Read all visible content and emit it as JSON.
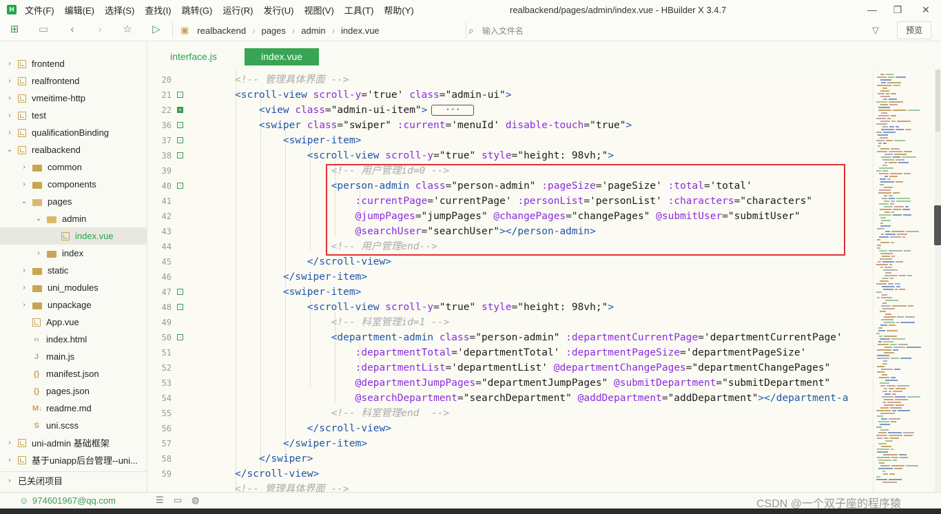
{
  "titlebar": {
    "menus": [
      "文件(F)",
      "编辑(E)",
      "选择(S)",
      "查找(I)",
      "跳转(G)",
      "运行(R)",
      "发行(U)",
      "视图(V)",
      "工具(T)",
      "帮助(Y)"
    ],
    "window_title": "realbackend/pages/admin/index.vue - HBuilder X 3.4.7"
  },
  "toolbar": {
    "breadcrumb": [
      "realbackend",
      "pages",
      "admin",
      "index.vue"
    ],
    "search_placeholder": "输入文件名",
    "preview_label": "预览"
  },
  "sidebar": {
    "items": [
      {
        "label": "frontend",
        "depth": 0,
        "kind": "project",
        "open": false
      },
      {
        "label": "realfrontend",
        "depth": 0,
        "kind": "project",
        "open": false
      },
      {
        "label": "vmeitime-http",
        "depth": 0,
        "kind": "project",
        "open": false
      },
      {
        "label": "test",
        "depth": 0,
        "kind": "project",
        "open": false
      },
      {
        "label": "qualificationBinding",
        "depth": 0,
        "kind": "project",
        "open": false
      },
      {
        "label": "realbackend",
        "depth": 0,
        "kind": "project",
        "open": true
      },
      {
        "label": "common",
        "depth": 1,
        "kind": "folder",
        "open": false
      },
      {
        "label": "components",
        "depth": 1,
        "kind": "folder",
        "open": false
      },
      {
        "label": "pages",
        "depth": 1,
        "kind": "folder",
        "open": true
      },
      {
        "label": "admin",
        "depth": 2,
        "kind": "folder",
        "open": true
      },
      {
        "label": "index.vue",
        "depth": 3,
        "kind": "vue",
        "selected": true
      },
      {
        "label": "index",
        "depth": 2,
        "kind": "folder",
        "open": false
      },
      {
        "label": "static",
        "depth": 1,
        "kind": "folder",
        "open": false
      },
      {
        "label": "uni_modules",
        "depth": 1,
        "kind": "folder",
        "open": false
      },
      {
        "label": "unpackage",
        "depth": 1,
        "kind": "folder",
        "open": false
      },
      {
        "label": "App.vue",
        "depth": 1,
        "kind": "vue"
      },
      {
        "label": "index.html",
        "depth": 1,
        "kind": "html"
      },
      {
        "label": "main.js",
        "depth": 1,
        "kind": "js"
      },
      {
        "label": "manifest.json",
        "depth": 1,
        "kind": "json"
      },
      {
        "label": "pages.json",
        "depth": 1,
        "kind": "json"
      },
      {
        "label": "readme.md",
        "depth": 1,
        "kind": "md"
      },
      {
        "label": "uni.scss",
        "depth": 1,
        "kind": "scss"
      },
      {
        "label": "uni-admin 基础框架",
        "depth": 0,
        "kind": "project",
        "open": false
      },
      {
        "label": "基于uniapp后台管理--uni...",
        "depth": 0,
        "kind": "project",
        "open": false
      }
    ],
    "closed_projects_label": "已关闭项目"
  },
  "tabs": [
    {
      "label": "interface.js",
      "active": false
    },
    {
      "label": "index.vue",
      "active": true
    }
  ],
  "editor": {
    "line_numbers": [
      "20",
      "21",
      "22",
      "36",
      "37",
      "38",
      "39",
      "40",
      "41",
      "42",
      "43",
      "44",
      "45",
      "46",
      "47",
      "48",
      "49",
      "50",
      "51",
      "52",
      "53",
      "54",
      "55",
      "56",
      "57",
      "58",
      "59"
    ],
    "fold_markers": [
      "",
      "-",
      "+",
      "-",
      "-",
      "-",
      "",
      "-",
      "",
      "",
      "",
      "",
      "",
      "",
      "-",
      "-",
      "",
      "-",
      "",
      "",
      "",
      "",
      "",
      "",
      "",
      "",
      ""
    ],
    "ellipsis": "···"
  },
  "status": {
    "account": "974601967@qq.com",
    "watermark": "CSDN @一个双子座的程序猿"
  }
}
